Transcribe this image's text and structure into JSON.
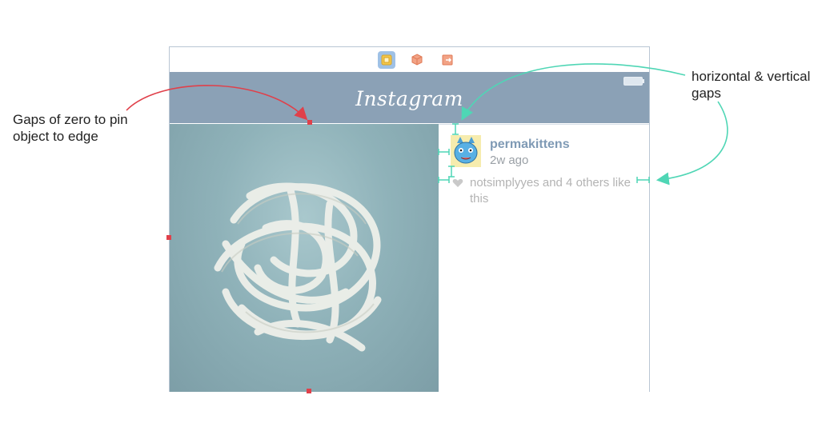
{
  "annotations": {
    "left": "Gaps of zero to pin object to edge",
    "right": "horizontal & vertical gaps"
  },
  "toolbar": {
    "icons": [
      "view-controller-icon",
      "first-responder-icon",
      "exit-icon"
    ]
  },
  "navbar": {
    "title": "Instagram"
  },
  "post": {
    "username": "permakittens",
    "time_ago": "2w ago",
    "likes_text": "notsimplyyes and 4 others like this"
  },
  "colors": {
    "pin_marker": "#e0404a",
    "constraint": "#4fd6b5",
    "navbar": "#8ba1b6",
    "username": "#7f9ab5"
  }
}
